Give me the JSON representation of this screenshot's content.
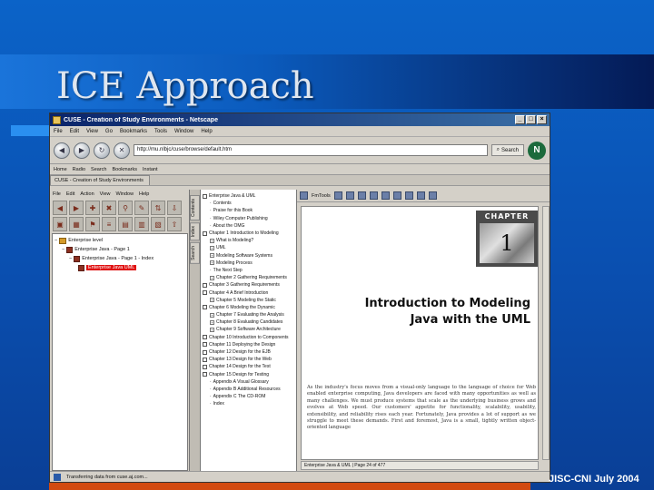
{
  "slide": {
    "title": "ICE Approach",
    "footer": "JISC-CNI July 2004"
  },
  "browser": {
    "window_title": "CUSE - Creation of Study Environments - Netscape",
    "menu": [
      "File",
      "Edit",
      "View",
      "Go",
      "Bookmarks",
      "Tools",
      "Window",
      "Help"
    ],
    "url": "http://mu.nlbjc/cuse/browse/default.htm",
    "search_label": "Search",
    "bookmarks": [
      "Home",
      "Radio",
      "Search",
      "Bookmarks",
      "Instant"
    ],
    "tab_label": "CUSE - Creation of Study Environments",
    "status_text": "Transferring data from cuse.aj.com..."
  },
  "app": {
    "menu": [
      "File",
      "Edit",
      "Action",
      "View",
      "Window",
      "Help"
    ],
    "tree": [
      {
        "label": "Enterprise level",
        "kind": "folder",
        "indent": 0
      },
      {
        "label": "Enterprise Java - Page 1",
        "kind": "node",
        "indent": 1
      },
      {
        "label": "Enterprise Java - Page 1 - Index",
        "kind": "node",
        "indent": 2
      },
      {
        "label": "Enterprise Java UML",
        "kind": "selected",
        "indent": 3
      }
    ],
    "vertical_tabs": [
      "Contents",
      "Index",
      "Search"
    ]
  },
  "toc": {
    "items": [
      {
        "label": "Enterprise Java & UML",
        "kind": "check"
      },
      {
        "label": "Contents",
        "kind": "sub"
      },
      {
        "label": "Praise for this Book",
        "kind": "sub"
      },
      {
        "label": "Wiley Computer Publishing",
        "kind": "sub"
      },
      {
        "label": "About the OMG",
        "kind": "sub"
      },
      {
        "label": "Chapter 1 Introduction to Modeling",
        "kind": "check"
      },
      {
        "label": "What is Modeling?",
        "kind": "plus"
      },
      {
        "label": "UML",
        "kind": "plus"
      },
      {
        "label": "Modeling Software Systems",
        "kind": "plus"
      },
      {
        "label": "Modeling Process",
        "kind": "plus"
      },
      {
        "label": "The Next Step",
        "kind": "sub"
      },
      {
        "label": "Chapter 2 Gathering Requirements",
        "kind": "plus"
      },
      {
        "label": "Chapter 3 Gathering Requirements",
        "kind": "check"
      },
      {
        "label": "Chapter 4 A Brief Introduction",
        "kind": "check"
      },
      {
        "label": "Chapter 5 Modeling the Static",
        "kind": "plus"
      },
      {
        "label": "Chapter 6 Modeling the Dynamic",
        "kind": "check"
      },
      {
        "label": "Chapter 7 Evaluating the Analysis",
        "kind": "plus"
      },
      {
        "label": "Chapter 8 Evaluating Candidates",
        "kind": "plus"
      },
      {
        "label": "Chapter 9 Software Architecture",
        "kind": "plus"
      },
      {
        "label": "Chapter 10 Introduction to Components",
        "kind": "check"
      },
      {
        "label": "Chapter 11 Deploying the Design",
        "kind": "check"
      },
      {
        "label": "Chapter 12 Design for the EJB",
        "kind": "check"
      },
      {
        "label": "Chapter 13 Design for the Web",
        "kind": "check"
      },
      {
        "label": "Chapter 14 Design for the Test",
        "kind": "check"
      },
      {
        "label": "Chapter 15 Design for Testing",
        "kind": "check"
      },
      {
        "label": "Appendix A Visual Glossary",
        "kind": "sub"
      },
      {
        "label": "Appendix B Additional Resources",
        "kind": "sub"
      },
      {
        "label": "Appendix C The CD-ROM",
        "kind": "sub"
      },
      {
        "label": "Index",
        "kind": "sub"
      }
    ]
  },
  "reader": {
    "toolbar_label": "FmTools",
    "chapter_label": "CHAPTER",
    "chapter_number": "1",
    "heading_line1": "Introduction to Modeling",
    "heading_line2": "Java with the UML",
    "body": "As the industry's focus moves from a visual-only language to the language of choice for Web enabled enterprise computing, Java developers are faced with many opportunities as well as many challenges. We must produce systems that scale as the underlying business grows and evolves at Web speed. Our customers' appetite for functionality, scalability, usability, extensibility, and reliability rises each year. Fortunately, Java provides a lot of support as we struggle to meet these demands. First and foremost, Java is a small, tightly written object-oriented language",
    "page_status": "Enterprise Java & UML | Page 24 of 477"
  }
}
